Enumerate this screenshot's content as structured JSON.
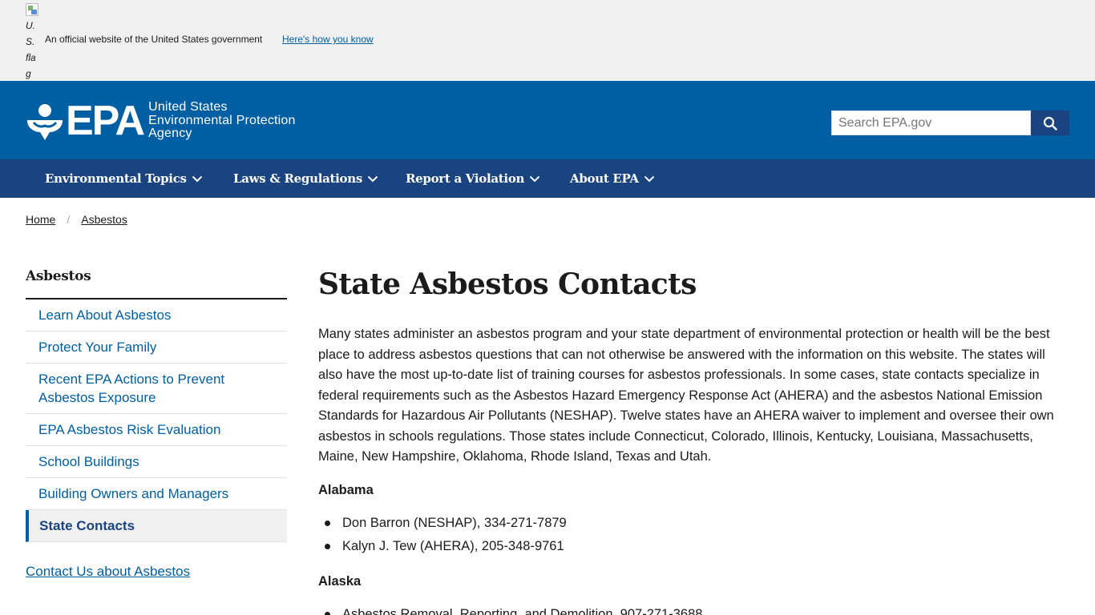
{
  "gov_banner": {
    "flag_alt_text": "U.S. flag",
    "flag_alt_lines": [
      "U.",
      "S.",
      "fla",
      "g"
    ],
    "official_text": "An official website of the United States government",
    "how_you_know_link": "Here's how you know"
  },
  "header": {
    "logo_text": "EPA",
    "agency_lines": [
      "United States",
      "Environmental Protection",
      "Agency"
    ],
    "search_placeholder": "Search EPA.gov",
    "search_button_icon": "search-icon"
  },
  "nav": {
    "items": [
      {
        "label": "Environmental Topics"
      },
      {
        "label": "Laws & Regulations"
      },
      {
        "label": "Report a Violation"
      },
      {
        "label": "About EPA"
      }
    ]
  },
  "breadcrumb": {
    "items": [
      "Home",
      "Asbestos"
    ],
    "separator": "/"
  },
  "sidebar": {
    "title": "Asbestos",
    "items": [
      {
        "label": "Learn About Asbestos"
      },
      {
        "label": "Protect Your Family"
      },
      {
        "label": "Recent EPA Actions to Prevent Asbestos Exposure"
      },
      {
        "label": "EPA Asbestos Risk Evaluation"
      },
      {
        "label": "School Buildings"
      },
      {
        "label": "Building Owners and Managers"
      },
      {
        "label": "State Contacts",
        "active": true
      }
    ],
    "contact_link": "Contact Us about Asbestos"
  },
  "main": {
    "title": "State Asbestos Contacts",
    "intro": "Many states administer an asbestos program and your state department of environmental protection or health will be the best place to address asbestos questions that can not otherwise be answered with the information on this website. The states will also have the most up-to-date list of training courses for asbestos professionals. In some cases, state contacts specialize in federal requirements such as the Asbestos Hazard Emergency Response Act (AHERA) and the asbestos National Emission Standards for Hazardous Air Pollutants (NESHAP). Twelve states have an AHERA waiver to implement and oversee their own asbestos in schools regulations. Those states include Connecticut, Colorado, Illinois, Kentucky, Louisiana, Massachusetts, Maine, New Hampshire, Oklahoma, Rhode Island, Texas and Utah.",
    "states": [
      {
        "name": "Alabama",
        "contacts": [
          "Don Barron (NESHAP), 334-271-7879",
          "Kalyn J. Tew (AHERA), 205-348-9761"
        ]
      },
      {
        "name": "Alaska",
        "contacts": [
          "Asbestos Removal, Reporting, and Demolition, 907-271-3688"
        ]
      }
    ]
  },
  "colors": {
    "header_blue": "#005ea2",
    "nav_blue": "#1a4480",
    "link_blue": "#005ea2",
    "banner_gray": "#f0f0f0"
  }
}
